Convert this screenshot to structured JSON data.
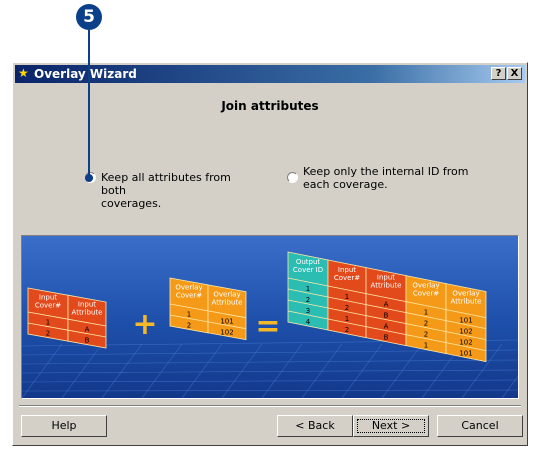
{
  "callout": {
    "number": "5"
  },
  "window": {
    "title": "Overlay Wizard",
    "help_button": "?",
    "close_button": "X"
  },
  "heading": "Join attributes",
  "options": [
    {
      "label_line1": "Keep all attributes from both",
      "label_line2": "coverages.",
      "selected": true
    },
    {
      "label_line1": "Keep only the internal ID from",
      "label_line2": "each coverage.",
      "selected": false
    }
  ],
  "illustration": {
    "colors": {
      "red": "#e24a1c",
      "orange": "#f59a18",
      "teal": "#2bbcb2",
      "plus": "#f5b829",
      "background": "#1d4faa"
    },
    "table_input": {
      "headers": [
        [
          "Input",
          "Cover#"
        ],
        [
          "Input",
          "Attribute"
        ]
      ],
      "rows": [
        [
          "1",
          "A"
        ],
        [
          "2",
          "B"
        ]
      ]
    },
    "table_overlay": {
      "headers": [
        [
          "Overlay",
          "Cover#"
        ],
        [
          "Overlay",
          "Attribute"
        ]
      ],
      "rows": [
        [
          "1",
          "101"
        ],
        [
          "2",
          "102"
        ]
      ]
    },
    "table_output": {
      "headers": [
        [
          "Output",
          "Cover ID"
        ],
        [
          "Input",
          "Cover#"
        ],
        [
          "Input",
          "Attribute"
        ],
        [
          "Overlay",
          "Cover#"
        ],
        [
          "Overlay",
          "Attribute"
        ]
      ],
      "rows": [
        [
          "1",
          "1",
          "A",
          "1",
          "101"
        ],
        [
          "2",
          "2",
          "B",
          "2",
          "102"
        ],
        [
          "3",
          "1",
          "A",
          "2",
          "102"
        ],
        [
          "4",
          "2",
          "B",
          "1",
          "101"
        ]
      ]
    },
    "plus": "+",
    "equals": "="
  },
  "buttons": {
    "help": "Help",
    "back": "< Back",
    "next": "Next >",
    "cancel": "Cancel"
  }
}
